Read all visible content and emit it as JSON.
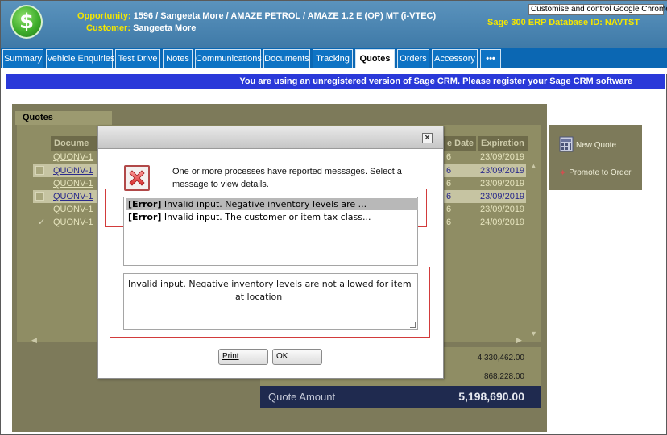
{
  "header": {
    "opportunity_label": "Opportunity:",
    "opportunity_value": "1596 / Sangeeta More / AMAZE PETROL / AMAZE 1.2 E (OP) MT (i-VTEC)",
    "customer_label": "Customer:",
    "customer_value": "Sangeeta More",
    "chrome_tooltip": "Customise and control Google Chrome",
    "sage_db": "Sage 300 ERP Database ID: NAVTST",
    "logo_glyph": "$"
  },
  "tabs": [
    {
      "label": "Summary"
    },
    {
      "label": "Vehicle Enquiries"
    },
    {
      "label": "Test Drive"
    },
    {
      "label": "Notes"
    },
    {
      "label": "Communications"
    },
    {
      "label": "Documents"
    },
    {
      "label": "Tracking"
    },
    {
      "label": "Quotes"
    },
    {
      "label": "Orders"
    },
    {
      "label": "Accessory"
    },
    {
      "label": "•••"
    }
  ],
  "active_tab": "Quotes",
  "banner": "You are using an unregistered version of Sage CRM. Please register your Sage CRM software",
  "quotes_panel": {
    "title": "Quotes",
    "columns": [
      "Docume",
      "e Date",
      "Expiration"
    ],
    "rows": [
      {
        "doc": "QUONV-1",
        "date": "6",
        "expiration": "23/09/2019",
        "checkbox": "none"
      },
      {
        "doc": "QUONV-1",
        "date": "6",
        "expiration": "23/09/2019",
        "checkbox": "empty"
      },
      {
        "doc": "QUONV-1",
        "date": "6",
        "expiration": "23/09/2019",
        "checkbox": "none"
      },
      {
        "doc": "QUONV-1",
        "date": "6",
        "expiration": "23/09/2019",
        "checkbox": "empty"
      },
      {
        "doc": "QUONV-1",
        "date": "6",
        "expiration": "23/09/2019",
        "checkbox": "none"
      },
      {
        "doc": "QUONV-1",
        "date": "6",
        "expiration": "24/09/2019",
        "checkbox": "check"
      }
    ]
  },
  "actions": {
    "new_quote": "New Quote",
    "promote": "Promote to Order"
  },
  "totals": {
    "line1": "4,330,462.00",
    "line2": "868,228.00",
    "quote_amount_label": "Quote Amount",
    "quote_amount_value": "5,198,690.00"
  },
  "dialog": {
    "close_glyph": "×",
    "message": "One or more processes have reported messages. Select a message to view details.",
    "errors": [
      {
        "tag": "[Error]",
        "text": "Invalid input. Negative inventory levels are ..."
      },
      {
        "tag": "[Error]",
        "text": "Invalid input. The customer or item tax class..."
      }
    ],
    "detail_line1": "Invalid input. Negative inventory levels are not allowed for item",
    "detail_line2": "at location",
    "print_label": "Print",
    "ok_label": "OK"
  },
  "colors": {
    "header_bg": "#4a86b4",
    "tab_bg": "#0e73c4",
    "banner_bg": "#2a39d9",
    "overlay": "#7d7a5a",
    "error_red": "#d23b3b"
  }
}
